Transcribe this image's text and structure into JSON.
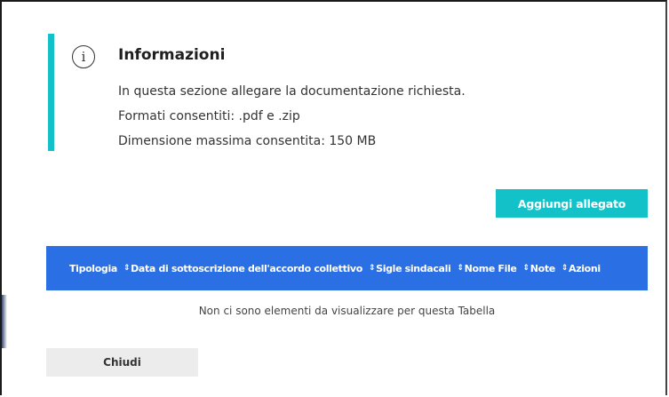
{
  "info": {
    "icon": "info-circle-icon",
    "title": "Informazioni",
    "lines": [
      "In questa sezione allegare la documentazione richiesta.",
      "Formati consentiti: .pdf e .zip",
      "Dimensione massima consentita: 150 MB"
    ]
  },
  "actions": {
    "add_attachment_label": "Aggiungi allegato",
    "close_label": "Chiudi"
  },
  "table": {
    "columns": [
      "Tipologia",
      "Data di sottoscrizione dell'accordo collettivo",
      "Sigle sindacali",
      "Nome File",
      "Note",
      "Azioni"
    ],
    "sort_icon": "⇕",
    "empty_message": "Non ci sono elementi da visualizzare per questa Tabella"
  },
  "colors": {
    "accent": "#13c1c9",
    "header_blue": "#2a6fe3",
    "close_bg": "#ececec"
  }
}
